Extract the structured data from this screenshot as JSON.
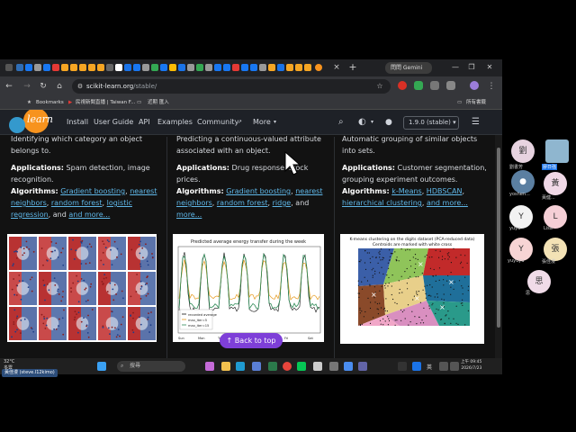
{
  "browser": {
    "tab_close": "×",
    "new_tab": "+",
    "gemini_label": "問問 Gemini",
    "window_controls": [
      "—",
      "❐",
      "✕"
    ],
    "url_host": "scikit-learn.org",
    "url_path": "/stable/",
    "bookmarks": [
      {
        "label": "Bookmarks"
      },
      {
        "label": "民視新聞直播 | Taiwan F..."
      },
      {
        "label": "近期 匯入"
      },
      {
        "label": "所有書籤"
      }
    ]
  },
  "site": {
    "nav": [
      "Install",
      "User Guide",
      "API",
      "Examples",
      "Community",
      "More"
    ],
    "more_caret": "▾",
    "version": "1.9.0 (stable)",
    "logo_text": "learn"
  },
  "cards": [
    {
      "intro": "Identifying which category an object belongs to.",
      "applications_label": "Applications:",
      "applications": "Spam detection, image recognition.",
      "algorithms_label": "Algorithms:",
      "links": [
        "Gradient boosting",
        "nearest neighbors",
        "random forest",
        "logistic regression"
      ],
      "and_more": "and more..."
    },
    {
      "intro": "Predicting a continuous-valued attribute associated with an object.",
      "applications_label": "Applications:",
      "applications": "Drug response, stock prices.",
      "algorithms_label": "Algorithms:",
      "links": [
        "Gradient boosting",
        "nearest neighbors",
        "random forest",
        "ridge"
      ],
      "and_more": "more...",
      "plot_title": "Predicted average energy transfer during the week",
      "legend": [
        "recorded average",
        "max_iter=5",
        "max_iter=15"
      ],
      "days": [
        "Sun",
        "Mon",
        "Tue",
        "Wed",
        "Thu",
        "Fri",
        "Sat"
      ]
    },
    {
      "intro": "Automatic grouping of similar objects into sets.",
      "applications_label": "Applications:",
      "applications": "Customer segmentation, grouping experiment outcomes.",
      "algorithms_label": "Algorithms:",
      "links": [
        "k-Means",
        "HDBSCAN",
        "hierarchical clustering"
      ],
      "and_more": "and more...",
      "plot_title": "K-means clustering on the digits dataset (PCA-reduced data)",
      "plot_subtitle": "Centroids are marked with white cross"
    }
  ],
  "back_to_top": "Back to top",
  "participants": [
    {
      "initial": "劉",
      "name": "劉書芳",
      "color": "#e7d3e0"
    },
    {
      "initial": "",
      "name": "廖日強",
      "color": "#8fb6cf"
    },
    {
      "initial": "",
      "name": "yoshen...",
      "color": "#5b7fa1"
    },
    {
      "initial": "黃",
      "name": "黃健...",
      "color": "#f0d8e6"
    },
    {
      "initial": "Y",
      "name": "yuyu",
      "color": "#f2f2f2"
    },
    {
      "initial": "L",
      "name": "Lisa",
      "color": "#f5cfd6"
    },
    {
      "initial": "Y",
      "name": "yuyuyu",
      "color": "#f7d4d4"
    },
    {
      "initial": "張",
      "name": "張佳漫",
      "color": "#f3e2b5"
    },
    {
      "initial": "思",
      "name": "思",
      "color": "#f0dbe8"
    }
  ],
  "taskbar": {
    "weather_temp": "32°C",
    "weather_desc": "多雲",
    "search_placeholder": "搜尋",
    "lang": "英",
    "time": "上午 09:45",
    "date": "2026/7/23",
    "tooltip": "黃佳漫 (steve.l12kimo)"
  }
}
